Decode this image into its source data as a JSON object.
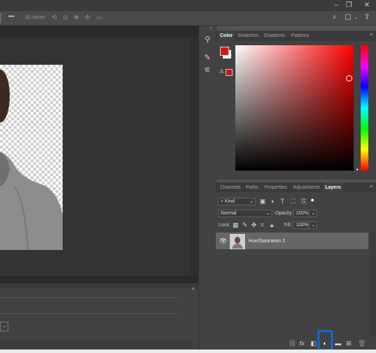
{
  "toolbar_options": {
    "more_label": "•••",
    "mode_label": "3D Mode:"
  },
  "color_panel": {
    "tabs": [
      "Color",
      "Swatches",
      "Gradients",
      "Patterns"
    ],
    "foreground_color": "#d41818",
    "background_color": "#ffffff"
  },
  "layers_panel": {
    "tabs": [
      "Channels",
      "Paths",
      "Properties",
      "Adjustments",
      "Layers"
    ],
    "filter_kind": "Kind",
    "blend_mode": "Normal",
    "opacity_label": "Opacity:",
    "opacity_value": "100%",
    "lock_label": "Lock:",
    "fill_label": "Fill:",
    "fill_value": "100%",
    "layer_name": "Hue/Saturation 2",
    "fx_label": "fx"
  },
  "highlight_color": "#0a6ad6"
}
